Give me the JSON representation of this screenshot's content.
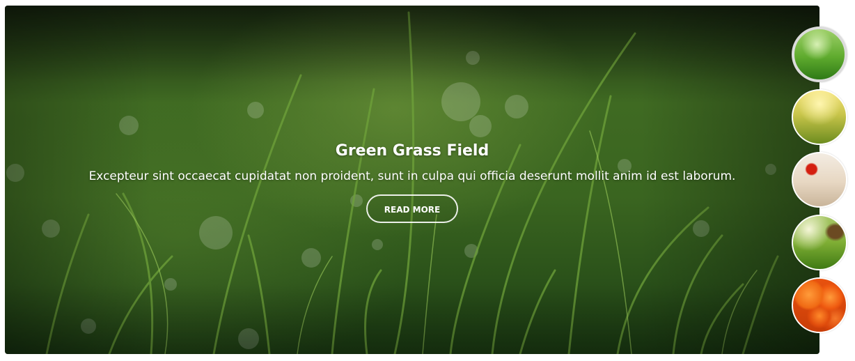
{
  "slide": {
    "title": "Green Grass Field",
    "description": "Excepteur sint occaecat cupidatat non proident, sunt in culpa qui officia deserunt mollit anim id est laborum.",
    "button_label": "READ MORE"
  },
  "thumbnails": [
    {
      "name": "green-grass",
      "active": true
    },
    {
      "name": "yellow-field",
      "active": false
    },
    {
      "name": "red-poppy",
      "active": false
    },
    {
      "name": "meadow-tree",
      "active": false
    },
    {
      "name": "orange-roses",
      "active": false
    }
  ]
}
